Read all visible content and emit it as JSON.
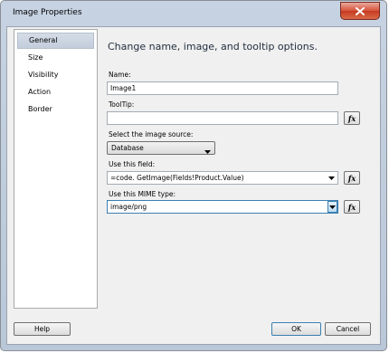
{
  "window": {
    "title": "Image Properties"
  },
  "nav": {
    "items": [
      "General",
      "Size",
      "Visibility",
      "Action",
      "Border"
    ],
    "selected": "General"
  },
  "main": {
    "heading": "Change name, image, and tooltip options.",
    "name_label": "Name:",
    "name_value": "Image1",
    "tooltip_label": "ToolTip:",
    "tooltip_value": "",
    "source_label": "Select the image source:",
    "source_value": "Database",
    "field_label": "Use this field:",
    "field_value": "=code. GetImage(Fields!Product.Value)",
    "mime_label": "Use this MIME type:",
    "mime_value": "image/png",
    "fx_label": "fx"
  },
  "footer": {
    "help_label": "Help",
    "ok_label": "OK",
    "cancel_label": "Cancel"
  },
  "icons": {
    "close": "close-icon",
    "dropdown": "chevron-down-icon",
    "expression": "fx-icon"
  }
}
